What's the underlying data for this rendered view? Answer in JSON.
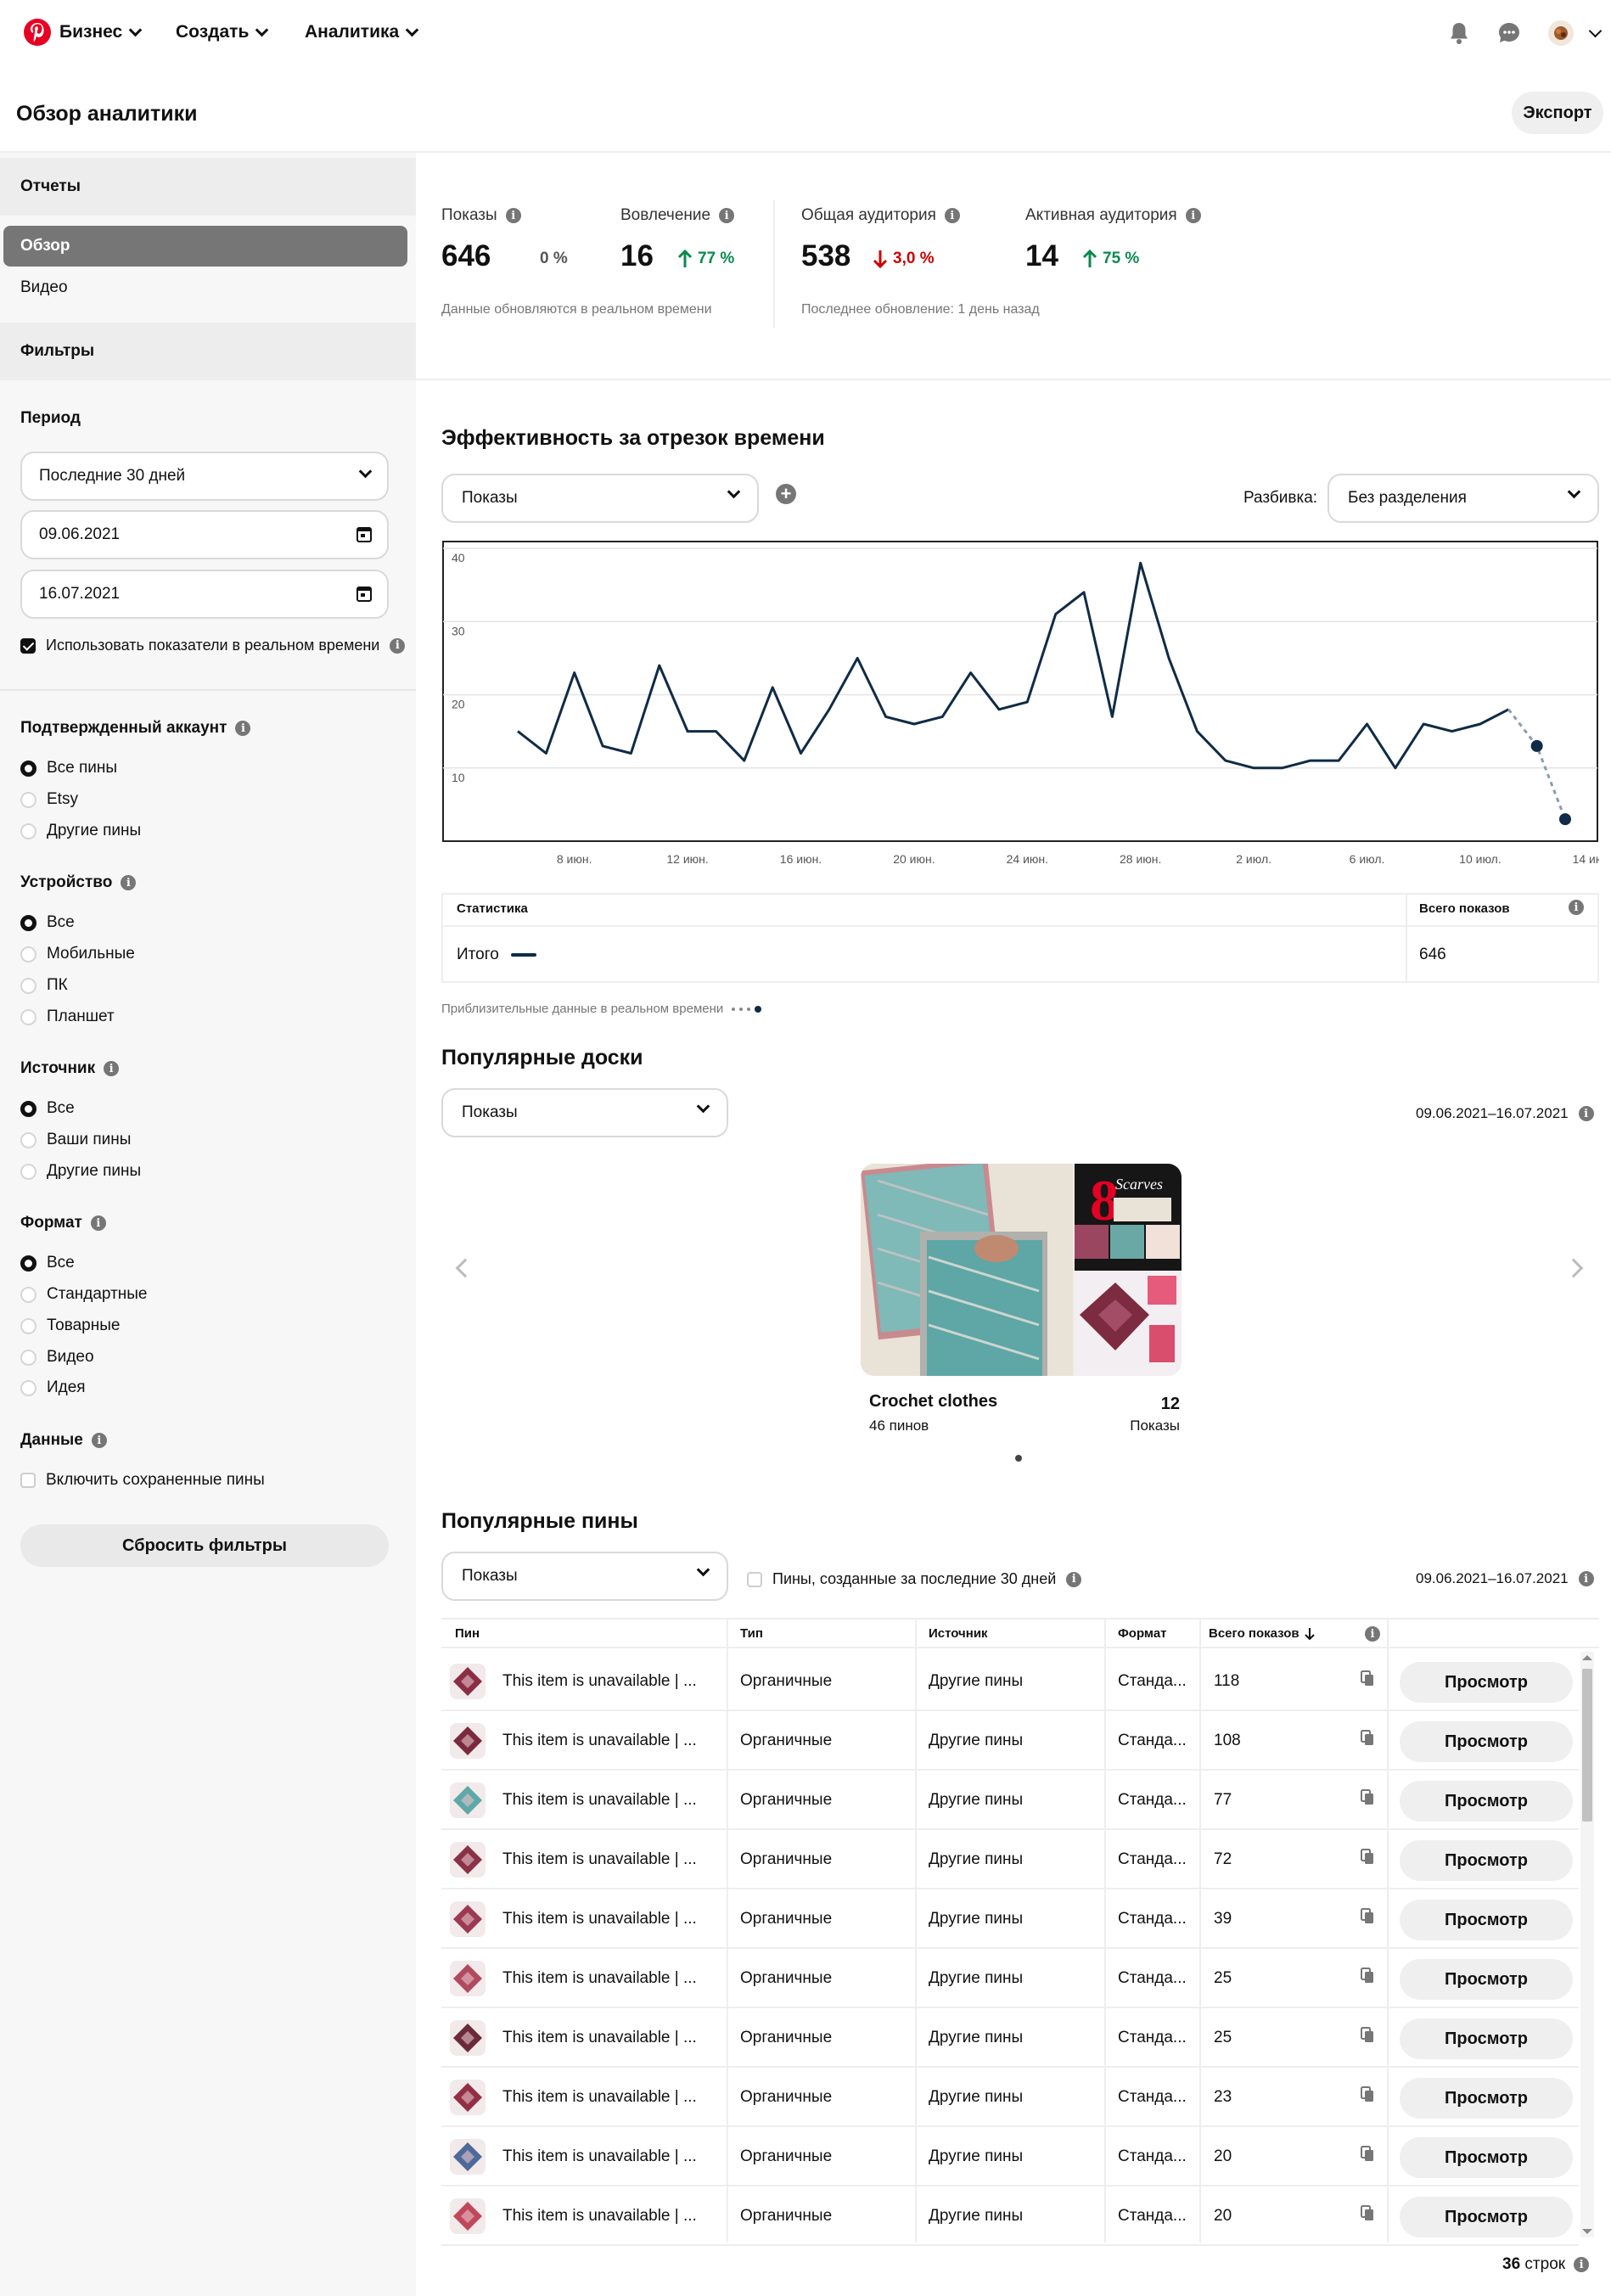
{
  "nav": {
    "items": [
      {
        "label": "Бизнес"
      },
      {
        "label": "Создать"
      },
      {
        "label": "Аналитика"
      }
    ]
  },
  "header": {
    "title": "Обзор аналитики",
    "export_label": "Экспорт"
  },
  "sidebar": {
    "reports_label": "Отчеты",
    "reports": [
      {
        "label": "Обзор",
        "selected": true
      },
      {
        "label": "Видео",
        "selected": false
      }
    ],
    "filters_label": "Фильтры",
    "period_label": "Период",
    "period_value": "Последние 30 дней",
    "date_from": "09.06.2021",
    "date_to": "16.07.2021",
    "realtime_label": "Использовать показатели в реальном времени",
    "realtime_checked": true,
    "groups": [
      {
        "label": "Подтвержденный аккаунт",
        "options": [
          "Все пины",
          "Etsy",
          "Другие пины"
        ],
        "selected": 0
      },
      {
        "label": "Устройство",
        "options": [
          "Все",
          "Мобильные",
          "ПК",
          "Планшет"
        ],
        "selected": 0
      },
      {
        "label": "Источник",
        "options": [
          "Все",
          "Ваши пины",
          "Другие пины"
        ],
        "selected": 0
      },
      {
        "label": "Формат",
        "options": [
          "Все",
          "Стандартные",
          "Товарные",
          "Видео",
          "Идея"
        ],
        "selected": 0
      }
    ],
    "data_label": "Данные",
    "include_saved_label": "Включить сохраненные пины",
    "reset_label": "Сбросить фильтры"
  },
  "metrics": [
    {
      "label": "Показы",
      "value": "646",
      "delta": "0 %",
      "trend": "flat"
    },
    {
      "label": "Вовлечение",
      "value": "16",
      "delta": "77 %",
      "trend": "up"
    },
    {
      "label": "Общая аудитория",
      "value": "538",
      "delta": "3,0 %",
      "trend": "down"
    },
    {
      "label": "Активная аудитория",
      "value": "14",
      "delta": "75 %",
      "trend": "up"
    }
  ],
  "metrics_notes": {
    "realtime": "Данные обновляются в реальном времени",
    "last_update": "Последнее обновление: 1 день назад"
  },
  "performance": {
    "title": "Эффективность за отрезок времени",
    "metric_value": "Показы",
    "breakdown_label": "Разбивка:",
    "breakdown_value": "Без разделения"
  },
  "chart_data": {
    "type": "line",
    "title": "",
    "xlabel": "",
    "ylabel": "",
    "ylim": [
      0,
      40
    ],
    "yticks": [
      10,
      20,
      30,
      40
    ],
    "x_tick_labels": [
      "8 июн.",
      "12 июн.",
      "16 июн.",
      "20 июн.",
      "24 июн.",
      "28 июн.",
      "2 июл.",
      "6 июл.",
      "10 июл.",
      "14 июл."
    ],
    "x_tick_index": [
      2,
      6,
      10,
      14,
      18,
      22,
      26,
      30,
      34,
      38
    ],
    "grid": true,
    "series": [
      {
        "name": "Итого",
        "values": [
          15,
          12,
          23,
          13,
          12,
          24,
          15,
          15,
          11,
          21,
          12,
          18,
          25,
          17,
          16,
          17,
          23,
          18,
          19,
          31,
          34,
          17,
          38,
          25,
          15,
          11,
          10,
          10,
          11,
          11,
          16,
          10,
          16,
          15,
          16,
          18,
          13,
          3
        ],
        "realtime_from_index": 35
      }
    ]
  },
  "stats_table": {
    "col_stat": "Статистика",
    "col_total": "Всего показов",
    "row_label": "Итого",
    "row_value": "646",
    "approx_note": "Приблизительные данные в реальном времени"
  },
  "boards": {
    "title": "Популярные доски",
    "metric_value": "Показы",
    "date_range": "09.06.2021–16.07.2021",
    "items": [
      {
        "name": "Crochet clothes",
        "pins": "46 пинов",
        "value": "12",
        "value_label": "Показы",
        "image_text": "8",
        "image_caption": "Scarves"
      }
    ]
  },
  "pins": {
    "title": "Популярные пины",
    "metric_value": "Показы",
    "recent_label": "Пины, созданные за последние 30 дней",
    "date_range": "09.06.2021–16.07.2021",
    "columns": [
      "Пин",
      "Тип",
      "Источник",
      "Формат",
      "Всего показов"
    ],
    "view_label": "Просмотр",
    "rows": [
      {
        "title": "This item is unavailable | ...",
        "type": "Органичные",
        "source": "Другие пины",
        "format": "Станда...",
        "total": "118",
        "thumb": "#8b2e45"
      },
      {
        "title": "This item is unavailable | ...",
        "type": "Органичные",
        "source": "Другие пины",
        "format": "Станда...",
        "total": "108",
        "thumb": "#7a2a3e"
      },
      {
        "title": "This item is unavailable | ...",
        "type": "Органичные",
        "source": "Другие пины",
        "format": "Станда...",
        "total": "77",
        "thumb": "#5fa8a8"
      },
      {
        "title": "This item is unavailable | ...",
        "type": "Органичные",
        "source": "Другие пины",
        "format": "Станда...",
        "total": "72",
        "thumb": "#8a3247"
      },
      {
        "title": "This item is unavailable | ...",
        "type": "Органичные",
        "source": "Другие пины",
        "format": "Станда...",
        "total": "39",
        "thumb": "#9b3a52"
      },
      {
        "title": "This item is unavailable | ...",
        "type": "Органичные",
        "source": "Другие пины",
        "format": "Станда...",
        "total": "25",
        "thumb": "#b04a5e"
      },
      {
        "title": "This item is unavailable | ...",
        "type": "Органичные",
        "source": "Другие пины",
        "format": "Станда...",
        "total": "25",
        "thumb": "#6b2a3a"
      },
      {
        "title": "This item is unavailable | ...",
        "type": "Органичные",
        "source": "Другие пины",
        "format": "Станда...",
        "total": "23",
        "thumb": "#922f44"
      },
      {
        "title": "This item is unavailable | ...",
        "type": "Органичные",
        "source": "Другие пины",
        "format": "Станда...",
        "total": "20",
        "thumb": "#4e6a9a"
      },
      {
        "title": "This item is unavailable | ...",
        "type": "Органичные",
        "source": "Другие пины",
        "format": "Станда...",
        "total": "20",
        "thumb": "#c0485a"
      }
    ],
    "row_count": "36",
    "row_count_label": "строк"
  },
  "colors": {
    "brand": "#e60023",
    "line": "#0f2b46",
    "up": "#0a8a4e",
    "down": "#cc0000"
  }
}
